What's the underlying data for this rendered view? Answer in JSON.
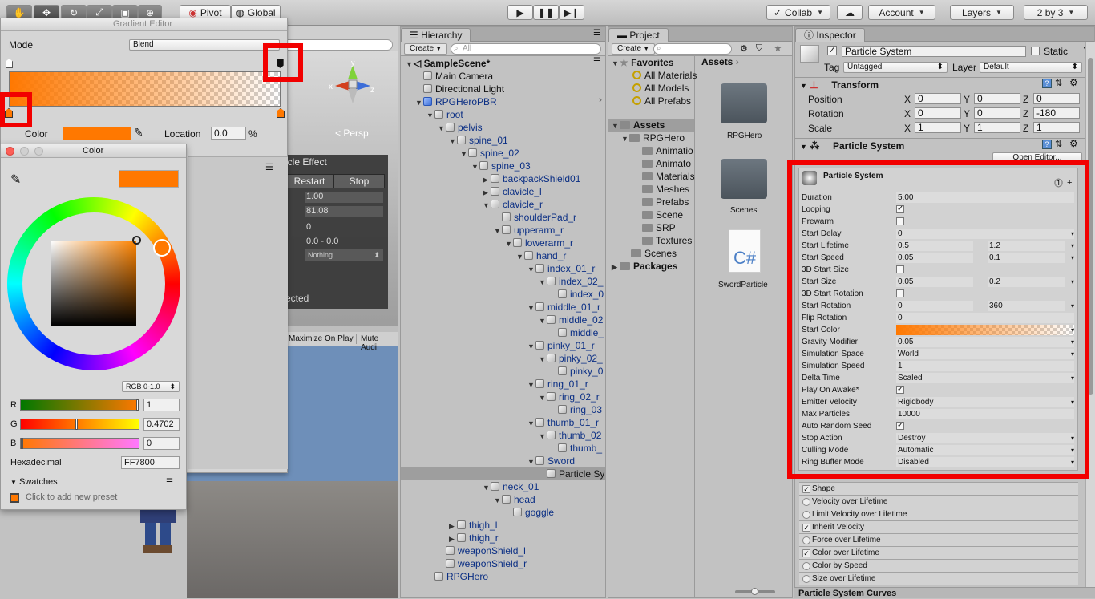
{
  "toolbar": {
    "pivot": "Pivot",
    "global": "Global",
    "collab": "Collab",
    "account": "Account",
    "layers": "Layers",
    "layout": "2 by 3"
  },
  "gradient_editor": {
    "title": "Gradient Editor",
    "mode_label": "Mode",
    "mode_value": "Blend",
    "color_label": "Color",
    "location_label": "Location",
    "location_value": "0.0",
    "location_unit": "%",
    "color_hex": "#FF7800"
  },
  "color_window": {
    "title": "Color",
    "mode": "RGB 0-1.0",
    "r_label": "R",
    "r_value": "1",
    "g_label": "G",
    "g_value": "0.4702",
    "b_label": "B",
    "b_value": "0",
    "hex_label": "Hexadecimal",
    "hex_value": "FF7800",
    "swatches_label": "Swatches",
    "swatches_hint": "Click to add new preset"
  },
  "scene": {
    "persp": "Persp",
    "effect_title": "icle Effect",
    "restart": "Restart",
    "stop": "Stop",
    "val1": "1.00",
    "val2": "81.08",
    "val3": "0",
    "val4": "0.0 - 0.0",
    "val5": "Nothing",
    "status": "ected"
  },
  "game": {
    "maximize": "Maximize On Play",
    "mute": "Mute Audi"
  },
  "hierarchy": {
    "tab": "Hierarchy",
    "create": "Create",
    "search_placeholder": "All",
    "scene": "SampleScene*",
    "rows": [
      {
        "label": "Main Camera",
        "indent": 0,
        "tri": "",
        "color": "black"
      },
      {
        "label": "Directional Light",
        "indent": 0,
        "tri": "",
        "color": "black"
      },
      {
        "label": "RPGHeroPBR",
        "indent": 0,
        "tri": "▼",
        "color": "blue"
      },
      {
        "label": "root",
        "indent": 1,
        "tri": "▼",
        "color": "blue"
      },
      {
        "label": "pelvis",
        "indent": 2,
        "tri": "▼",
        "color": "blue"
      },
      {
        "label": "spine_01",
        "indent": 3,
        "tri": "▼",
        "color": "blue"
      },
      {
        "label": "spine_02",
        "indent": 4,
        "tri": "▼",
        "color": "blue"
      },
      {
        "label": "spine_03",
        "indent": 5,
        "tri": "▼",
        "color": "blue"
      },
      {
        "label": "backpackShield01",
        "indent": 6,
        "tri": "▶",
        "color": "blue"
      },
      {
        "label": "clavicle_l",
        "indent": 6,
        "tri": "▶",
        "color": "blue"
      },
      {
        "label": "clavicle_r",
        "indent": 6,
        "tri": "▼",
        "color": "blue"
      },
      {
        "label": "shoulderPad_r",
        "indent": 7,
        "tri": "",
        "color": "blue"
      },
      {
        "label": "upperarm_r",
        "indent": 7,
        "tri": "▼",
        "color": "blue"
      },
      {
        "label": "lowerarm_r",
        "indent": 8,
        "tri": "▼",
        "color": "blue"
      },
      {
        "label": "hand_r",
        "indent": 9,
        "tri": "▼",
        "color": "blue"
      },
      {
        "label": "index_01_r",
        "indent": 10,
        "tri": "▼",
        "color": "blue"
      },
      {
        "label": "index_02_",
        "indent": 11,
        "tri": "▼",
        "color": "blue"
      },
      {
        "label": "index_0",
        "indent": 12,
        "tri": "",
        "color": "blue"
      },
      {
        "label": "middle_01_r",
        "indent": 10,
        "tri": "▼",
        "color": "blue"
      },
      {
        "label": "middle_02",
        "indent": 11,
        "tri": "▼",
        "color": "blue"
      },
      {
        "label": "middle_",
        "indent": 12,
        "tri": "",
        "color": "blue"
      },
      {
        "label": "pinky_01_r",
        "indent": 10,
        "tri": "▼",
        "color": "blue"
      },
      {
        "label": "pinky_02_",
        "indent": 11,
        "tri": "▼",
        "color": "blue"
      },
      {
        "label": "pinky_0",
        "indent": 12,
        "tri": "",
        "color": "blue"
      },
      {
        "label": "ring_01_r",
        "indent": 10,
        "tri": "▼",
        "color": "blue"
      },
      {
        "label": "ring_02_r",
        "indent": 11,
        "tri": "▼",
        "color": "blue"
      },
      {
        "label": "ring_03",
        "indent": 12,
        "tri": "",
        "color": "blue"
      },
      {
        "label": "thumb_01_r",
        "indent": 10,
        "tri": "▼",
        "color": "blue"
      },
      {
        "label": "thumb_02",
        "indent": 11,
        "tri": "▼",
        "color": "blue"
      },
      {
        "label": "thumb_",
        "indent": 12,
        "tri": "",
        "color": "blue"
      },
      {
        "label": "Sword",
        "indent": 10,
        "tri": "▼",
        "color": "blue"
      },
      {
        "label": "Particle Sy",
        "indent": 11,
        "tri": "",
        "color": "black",
        "selected": true
      },
      {
        "label": "neck_01",
        "indent": 6,
        "tri": "▼",
        "color": "blue"
      },
      {
        "label": "head",
        "indent": 7,
        "tri": "▼",
        "color": "blue"
      },
      {
        "label": "goggle",
        "indent": 8,
        "tri": "",
        "color": "blue"
      },
      {
        "label": "thigh_l",
        "indent": 3,
        "tri": "▶",
        "color": "blue"
      },
      {
        "label": "thigh_r",
        "indent": 3,
        "tri": "▶",
        "color": "blue"
      },
      {
        "label": "weaponShield_l",
        "indent": 2,
        "tri": "",
        "color": "blue"
      },
      {
        "label": "weaponShield_r",
        "indent": 2,
        "tri": "",
        "color": "blue"
      },
      {
        "label": "RPGHero",
        "indent": 1,
        "tri": "",
        "color": "blue"
      }
    ]
  },
  "project": {
    "tab": "Project",
    "create": "Create",
    "favorites": "Favorites",
    "fav_items": [
      "All Materials",
      "All Models",
      "All Prefabs"
    ],
    "assets": "Assets",
    "rpghero": "RPGHero",
    "sub_items": [
      "Animatio",
      "Animato",
      "Materials",
      "Meshes",
      "Prefabs",
      "Scene",
      "SRP",
      "Textures"
    ],
    "scenes": "Scenes",
    "packages": "Packages",
    "breadcrumb": "Assets",
    "grid_items": [
      "RPGHero",
      "Scenes",
      "SwordParticle"
    ],
    "cs_glyph": "C#"
  },
  "inspector": {
    "tab": "Inspector",
    "object_name": "Particle System",
    "static_label": "Static",
    "tag_label": "Tag",
    "tag_value": "Untagged",
    "layer_label": "Layer",
    "layer_value": "Default",
    "transform_title": "Transform",
    "position_label": "Position",
    "rotation_label": "Rotation",
    "scale_label": "Scale",
    "position": [
      "0",
      "0",
      "0"
    ],
    "rotation": [
      "0",
      "0",
      "-180"
    ],
    "scale": [
      "1",
      "1",
      "1"
    ],
    "ps_title": "Particle System",
    "open_editor": "Open Editor...",
    "ps_header": "Particle System",
    "axes": [
      "X",
      "Y",
      "Z"
    ],
    "props": [
      {
        "label": "Duration",
        "v1": "5.00"
      },
      {
        "label": "Looping",
        "check": "✓"
      },
      {
        "label": "Prewarm",
        "check": ""
      },
      {
        "label": "Start Delay",
        "v1": "0",
        "dd": true
      },
      {
        "label": "Start Lifetime",
        "v1": "0.5",
        "v2": "1.2",
        "dd": true
      },
      {
        "label": "Start Speed",
        "v1": "0.05",
        "v2": "0.1",
        "dd": true
      },
      {
        "label": "3D Start Size",
        "check": ""
      },
      {
        "label": "Start Size",
        "v1": "0.05",
        "v2": "0.2",
        "dd": true
      },
      {
        "label": "3D Start Rotation",
        "check": ""
      },
      {
        "label": "Start Rotation",
        "v1": "0",
        "v2": "360",
        "dd": true
      },
      {
        "label": "Flip Rotation",
        "v1": "0"
      },
      {
        "label": "Start Color",
        "gradient": true,
        "dd": true
      },
      {
        "label": "Gravity Modifier",
        "v1": "0.05",
        "dd": true
      },
      {
        "label": "Simulation Space",
        "v1": "World",
        "dd": true
      },
      {
        "label": "Simulation Speed",
        "v1": "1"
      },
      {
        "label": "Delta Time",
        "v1": "Scaled",
        "dd": true
      },
      {
        "label": "Play On Awake*",
        "check": "✓"
      },
      {
        "label": "Emitter Velocity",
        "v1": "Rigidbody",
        "dd": true
      },
      {
        "label": "Max Particles",
        "v1": "10000"
      },
      {
        "label": "Auto Random Seed",
        "check": "✓"
      },
      {
        "label": "Stop Action",
        "v1": "Destroy",
        "dd": true
      },
      {
        "label": "Culling Mode",
        "v1": "Automatic",
        "dd": true
      },
      {
        "label": "Ring Buffer Mode",
        "v1": "Disabled",
        "dd": true
      }
    ],
    "modules": [
      {
        "label": "Shape",
        "checked": true
      },
      {
        "label": "Velocity over Lifetime",
        "checked": false
      },
      {
        "label": "Limit Velocity over Lifetime",
        "checked": false
      },
      {
        "label": "Inherit Velocity",
        "checked": true
      },
      {
        "label": "Force over Lifetime",
        "checked": false
      },
      {
        "label": "Color over Lifetime",
        "checked": true
      },
      {
        "label": "Color by Speed",
        "checked": false
      },
      {
        "label": "Size over Lifetime",
        "checked": false
      }
    ],
    "curves_label": "Particle System Curves"
  },
  "colors": {
    "accent_orange": "#FF7800",
    "highlight_red": "#F20000"
  }
}
